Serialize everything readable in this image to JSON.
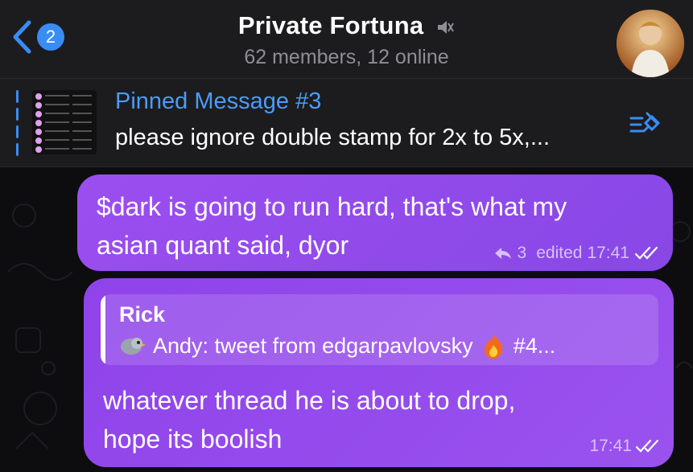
{
  "header": {
    "back_badge": "2",
    "title": "Private Fortuna",
    "subtitle": "62 members, 12 online"
  },
  "pinned": {
    "title": "Pinned Message #3",
    "text": "please ignore double stamp for 2x to 5x,..."
  },
  "messages": [
    {
      "text_line1": "$dark is going to run hard, that's what my",
      "text_line2": "asian quant said, dyor",
      "reply_count": "3",
      "edited": "edited",
      "time": "17:41"
    },
    {
      "reply_author": "Rick",
      "reply_text": "Andy: tweet from edgarpavlovsky",
      "reply_suffix": "#4...",
      "text_line1": "whatever thread he is about to drop,",
      "text_line2": "hope its boolish",
      "time": "17:41"
    }
  ],
  "colors": {
    "accent": "#3a8cf5",
    "bubble": "#9c4ef0",
    "header_bg": "#1c1c1e"
  },
  "icons": [
    "chevron-left-icon",
    "mute-icon",
    "pin-list-icon",
    "reply-arrow-icon",
    "double-check-icon",
    "bird-emoji-icon",
    "fire-emoji-icon"
  ]
}
